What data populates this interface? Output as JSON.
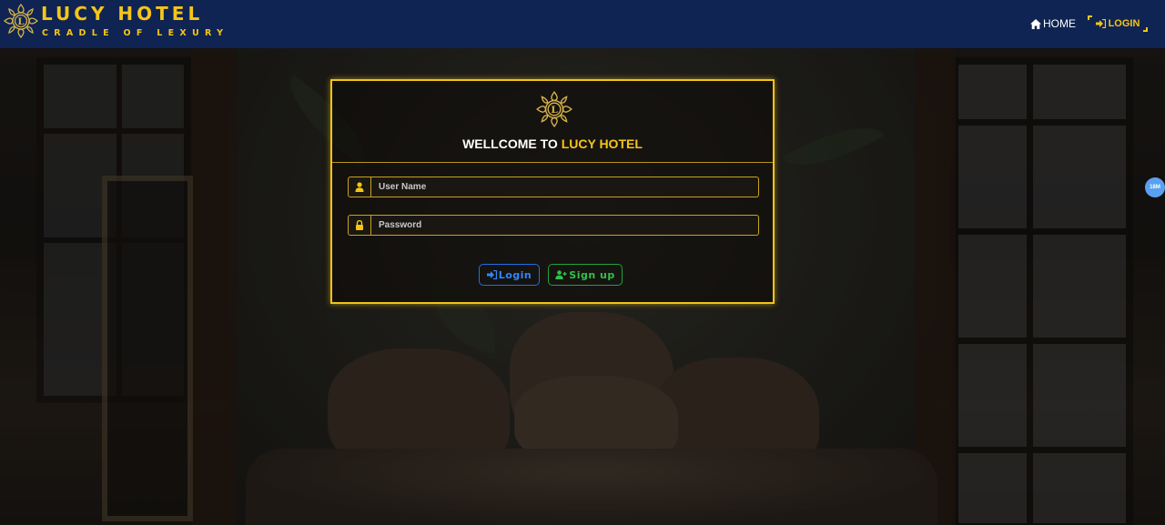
{
  "navbar": {
    "brand_title": "LUCY HOTEL",
    "brand_subtitle": "CRADLE OF LEXURY",
    "home_label": "HOME",
    "login_label": "LOGIN"
  },
  "login_card": {
    "title_prefix": "WELLCOME TO ",
    "title_highlight": "LUCY HOTEL",
    "username_placeholder": "User Name",
    "password_placeholder": "Password",
    "login_button": "Login",
    "signup_button": "Sign up"
  },
  "side_badge": "18M",
  "colors": {
    "navbar_bg": "#0f2452",
    "accent_gold": "#f5c518",
    "login_blue": "#2f86ff",
    "signup_green": "#2fc24a"
  },
  "icons": {
    "brand": "mandala-logo-icon",
    "home": "home-icon",
    "login": "sign-in-icon",
    "user": "user-icon",
    "password": "lock-icon",
    "signup": "user-plus-icon"
  }
}
